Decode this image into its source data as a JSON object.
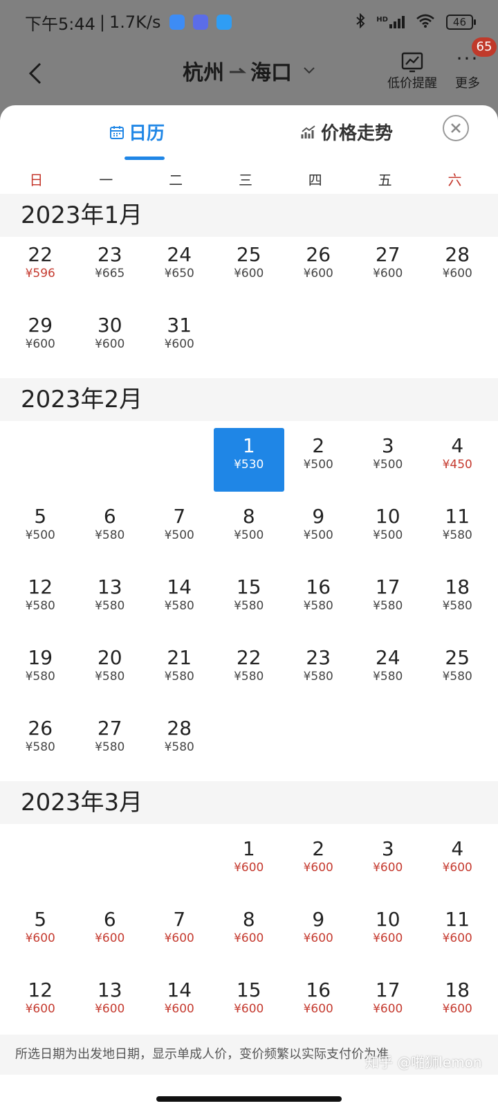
{
  "status_bar": {
    "time": "下午5:44",
    "speed": "1.7K/s",
    "battery": "46",
    "network": "HD"
  },
  "header": {
    "from": "杭州",
    "to": "海口",
    "price_alert_label": "低价提醒",
    "more_label": "更多",
    "badge_count": "65"
  },
  "tabs": {
    "calendar": "日历",
    "trend": "价格走势"
  },
  "weekdays": [
    "日",
    "一",
    "二",
    "三",
    "四",
    "五",
    "六"
  ],
  "months": [
    {
      "title": "2023年1月",
      "offset": 0,
      "days": [
        {
          "d": "22",
          "p": "¥596",
          "low": true
        },
        {
          "d": "23",
          "p": "¥665"
        },
        {
          "d": "24",
          "p": "¥650"
        },
        {
          "d": "25",
          "p": "¥600"
        },
        {
          "d": "26",
          "p": "¥600"
        },
        {
          "d": "27",
          "p": "¥600"
        },
        {
          "d": "28",
          "p": "¥600"
        },
        {
          "d": "29",
          "p": "¥600"
        },
        {
          "d": "30",
          "p": "¥600"
        },
        {
          "d": "31",
          "p": "¥600"
        }
      ]
    },
    {
      "title": "2023年2月",
      "offset": 3,
      "days": [
        {
          "d": "1",
          "p": "¥530",
          "selected": true
        },
        {
          "d": "2",
          "p": "¥500"
        },
        {
          "d": "3",
          "p": "¥500"
        },
        {
          "d": "4",
          "p": "¥450",
          "low": true
        },
        {
          "d": "5",
          "p": "¥500"
        },
        {
          "d": "6",
          "p": "¥580"
        },
        {
          "d": "7",
          "p": "¥500"
        },
        {
          "d": "8",
          "p": "¥500"
        },
        {
          "d": "9",
          "p": "¥500"
        },
        {
          "d": "10",
          "p": "¥500"
        },
        {
          "d": "11",
          "p": "¥580"
        },
        {
          "d": "12",
          "p": "¥580"
        },
        {
          "d": "13",
          "p": "¥580"
        },
        {
          "d": "14",
          "p": "¥580"
        },
        {
          "d": "15",
          "p": "¥580"
        },
        {
          "d": "16",
          "p": "¥580"
        },
        {
          "d": "17",
          "p": "¥580"
        },
        {
          "d": "18",
          "p": "¥580"
        },
        {
          "d": "19",
          "p": "¥580"
        },
        {
          "d": "20",
          "p": "¥580"
        },
        {
          "d": "21",
          "p": "¥580"
        },
        {
          "d": "22",
          "p": "¥580"
        },
        {
          "d": "23",
          "p": "¥580"
        },
        {
          "d": "24",
          "p": "¥580"
        },
        {
          "d": "25",
          "p": "¥580"
        },
        {
          "d": "26",
          "p": "¥580"
        },
        {
          "d": "27",
          "p": "¥580"
        },
        {
          "d": "28",
          "p": "¥580"
        }
      ]
    },
    {
      "title": "2023年3月",
      "offset": 3,
      "days": [
        {
          "d": "1",
          "p": "¥600",
          "low": true
        },
        {
          "d": "2",
          "p": "¥600",
          "low": true
        },
        {
          "d": "3",
          "p": "¥600",
          "low": true
        },
        {
          "d": "4",
          "p": "¥600",
          "low": true
        },
        {
          "d": "5",
          "p": "¥600",
          "low": true
        },
        {
          "d": "6",
          "p": "¥600",
          "low": true
        },
        {
          "d": "7",
          "p": "¥600",
          "low": true
        },
        {
          "d": "8",
          "p": "¥600",
          "low": true
        },
        {
          "d": "9",
          "p": "¥600",
          "low": true
        },
        {
          "d": "10",
          "p": "¥600",
          "low": true
        },
        {
          "d": "11",
          "p": "¥600",
          "low": true
        },
        {
          "d": "12",
          "p": "¥600",
          "low": true
        },
        {
          "d": "13",
          "p": "¥600",
          "low": true
        },
        {
          "d": "14",
          "p": "¥600",
          "low": true
        },
        {
          "d": "15",
          "p": "¥600",
          "low": true
        },
        {
          "d": "16",
          "p": "¥600",
          "low": true
        },
        {
          "d": "17",
          "p": "¥600",
          "low": true
        },
        {
          "d": "18",
          "p": "¥600",
          "low": true
        }
      ]
    }
  ],
  "footer_note": "所选日期为出发地日期，显示单成人价，变价频繁以实际支付价为准",
  "watermark": "知乎 @啪狮lemon",
  "colors": {
    "accent": "#1f86e6",
    "low_price": "#c53a2f"
  }
}
